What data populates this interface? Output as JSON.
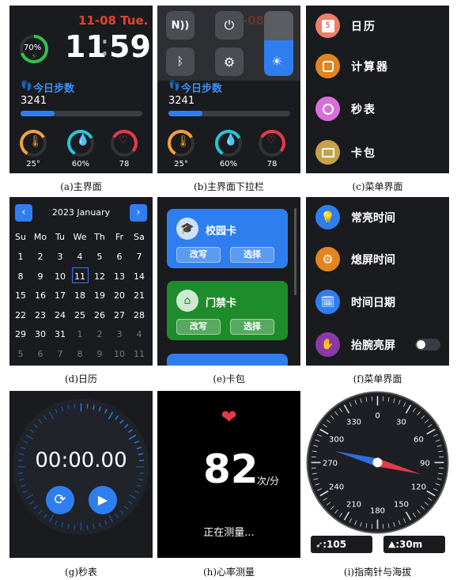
{
  "home": {
    "date": "11-08 Tue.",
    "time_h": "11",
    "time_colon": ":",
    "time_m": "59",
    "battery": "70%",
    "steps_title": "今日步数",
    "steps_value": "3241",
    "steps_progress": 0.28,
    "temp": "25°",
    "humidity": "60%",
    "heart": "78"
  },
  "captions": {
    "a": "(a)主界面",
    "b": "(b)主界面下拉栏",
    "c": "(c)菜单界面",
    "d": "(d)日历",
    "e": "(e)卡包",
    "f": "(f)菜单界面",
    "g": "(g)秒表",
    "h": "(h)心率测量",
    "i": "(i)指南针与海拔"
  },
  "menu_c": {
    "items": [
      "日历",
      "计算器",
      "秒表",
      "卡包"
    ],
    "calendar_icon_num": "5"
  },
  "calendar": {
    "title": "2023 January",
    "weekdays": [
      "Su",
      "Mo",
      "Tu",
      "We",
      "Th",
      "Fr",
      "Sa"
    ],
    "rows": [
      [
        "1",
        "2",
        "3",
        "4",
        "5",
        "6",
        "7"
      ],
      [
        "8",
        "9",
        "10",
        "11",
        "12",
        "13",
        "14"
      ],
      [
        "15",
        "16",
        "17",
        "18",
        "19",
        "20",
        "21"
      ],
      [
        "22",
        "23",
        "24",
        "25",
        "26",
        "27",
        "28"
      ],
      [
        "29",
        "30",
        "31",
        "1",
        "2",
        "3",
        "4"
      ],
      [
        "5",
        "6",
        "7",
        "8",
        "9",
        "10",
        "11"
      ]
    ],
    "selected": "11"
  },
  "wallet": {
    "card1": "校园卡",
    "card2": "门禁卡",
    "rewrite": "改写",
    "select": "选择"
  },
  "menu_f": {
    "items": [
      "常亮时间",
      "熄屏时间",
      "时间日期",
      "抬腕亮屏"
    ]
  },
  "stopwatch": {
    "time": "00:00.00"
  },
  "heartrate": {
    "value": "82",
    "unit": "次/分",
    "status": "正在测量..."
  },
  "compass": {
    "labels": [
      "0",
      "30",
      "60",
      "90",
      "120",
      "150",
      "180",
      "210",
      "240",
      "270",
      "300",
      "330"
    ],
    "heading": "105",
    "altitude": ":30m",
    "heading_prefix": ":"
  },
  "colors": {
    "accent_blue": "#2f7ef0",
    "date_red": "#e8412b",
    "bg": "#1a1b1f"
  }
}
